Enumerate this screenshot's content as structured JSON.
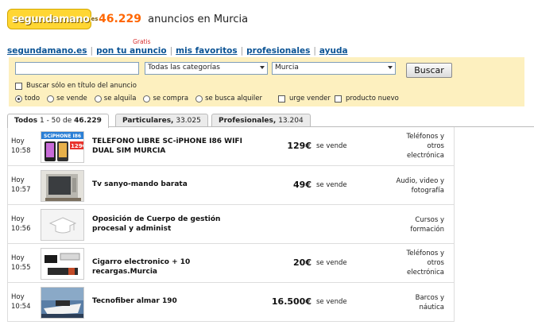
{
  "header": {
    "logo_text": "segundamano",
    "logo_suffix": "es",
    "ad_count": "46.229",
    "ad_count_suffix": "anuncios en Murcia"
  },
  "nav": {
    "items": [
      "segundamano.es",
      "pon tu anuncio",
      "mis favoritos",
      "profesionales",
      "ayuda"
    ],
    "badge": "Gratis"
  },
  "search": {
    "query_value": "",
    "category_value": "Todas las categorías",
    "region_value": "Murcia",
    "button_label": "Buscar",
    "title_only_label": "Buscar sólo en título del anuncio",
    "filters": [
      "todo",
      "se vende",
      "se alquila",
      "se compra",
      "se busca alquiler"
    ],
    "selected_filter": "todo",
    "urgent_label": "urge vender",
    "new_label": "producto nuevo"
  },
  "tabs": [
    {
      "label": "Todos",
      "count": "1 - 50 de",
      "total": "46.229"
    },
    {
      "label": "Particulares,",
      "count": "33.025"
    },
    {
      "label": "Profesionales,",
      "count": "13.204"
    }
  ],
  "listings": [
    {
      "day": "Hoy",
      "time": "10:58",
      "title": "TELEFONO LIBRE SC-iPHONE I86 WIFI DUAL SIM MURCIA",
      "price": "129€",
      "type": "se vende",
      "category": [
        "Teléfonos y",
        "otros",
        "electrónica"
      ],
      "thumb_text": "SCiPHONE I86",
      "thumb_price": "129€"
    },
    {
      "day": "Hoy",
      "time": "10:57",
      "title": "Tv sanyo-mando barata",
      "price": "49€",
      "type": "se vende",
      "category": [
        "Audio, video y",
        "fotografía"
      ]
    },
    {
      "day": "Hoy",
      "time": "10:56",
      "title": "Oposición de Cuerpo de gestión procesal y administ",
      "price": "",
      "type": "",
      "category": [
        "Cursos y",
        "formación"
      ]
    },
    {
      "day": "Hoy",
      "time": "10:55",
      "title": "Cigarro electronico + 10 recargas.Murcia",
      "price": "20€",
      "type": "se vende",
      "category": [
        "Teléfonos y",
        "otros",
        "electrónica"
      ]
    },
    {
      "day": "Hoy",
      "time": "10:54",
      "title": "Tecnofiber almar 190",
      "price": "16.500€",
      "type": "se vende",
      "category": [
        "Barcos y",
        "náutica"
      ]
    }
  ],
  "colors": {
    "accent": "#ff6600",
    "link": "#0b5394",
    "search_bg": "#fdf0bf",
    "logo_bg": "#ffd633"
  }
}
